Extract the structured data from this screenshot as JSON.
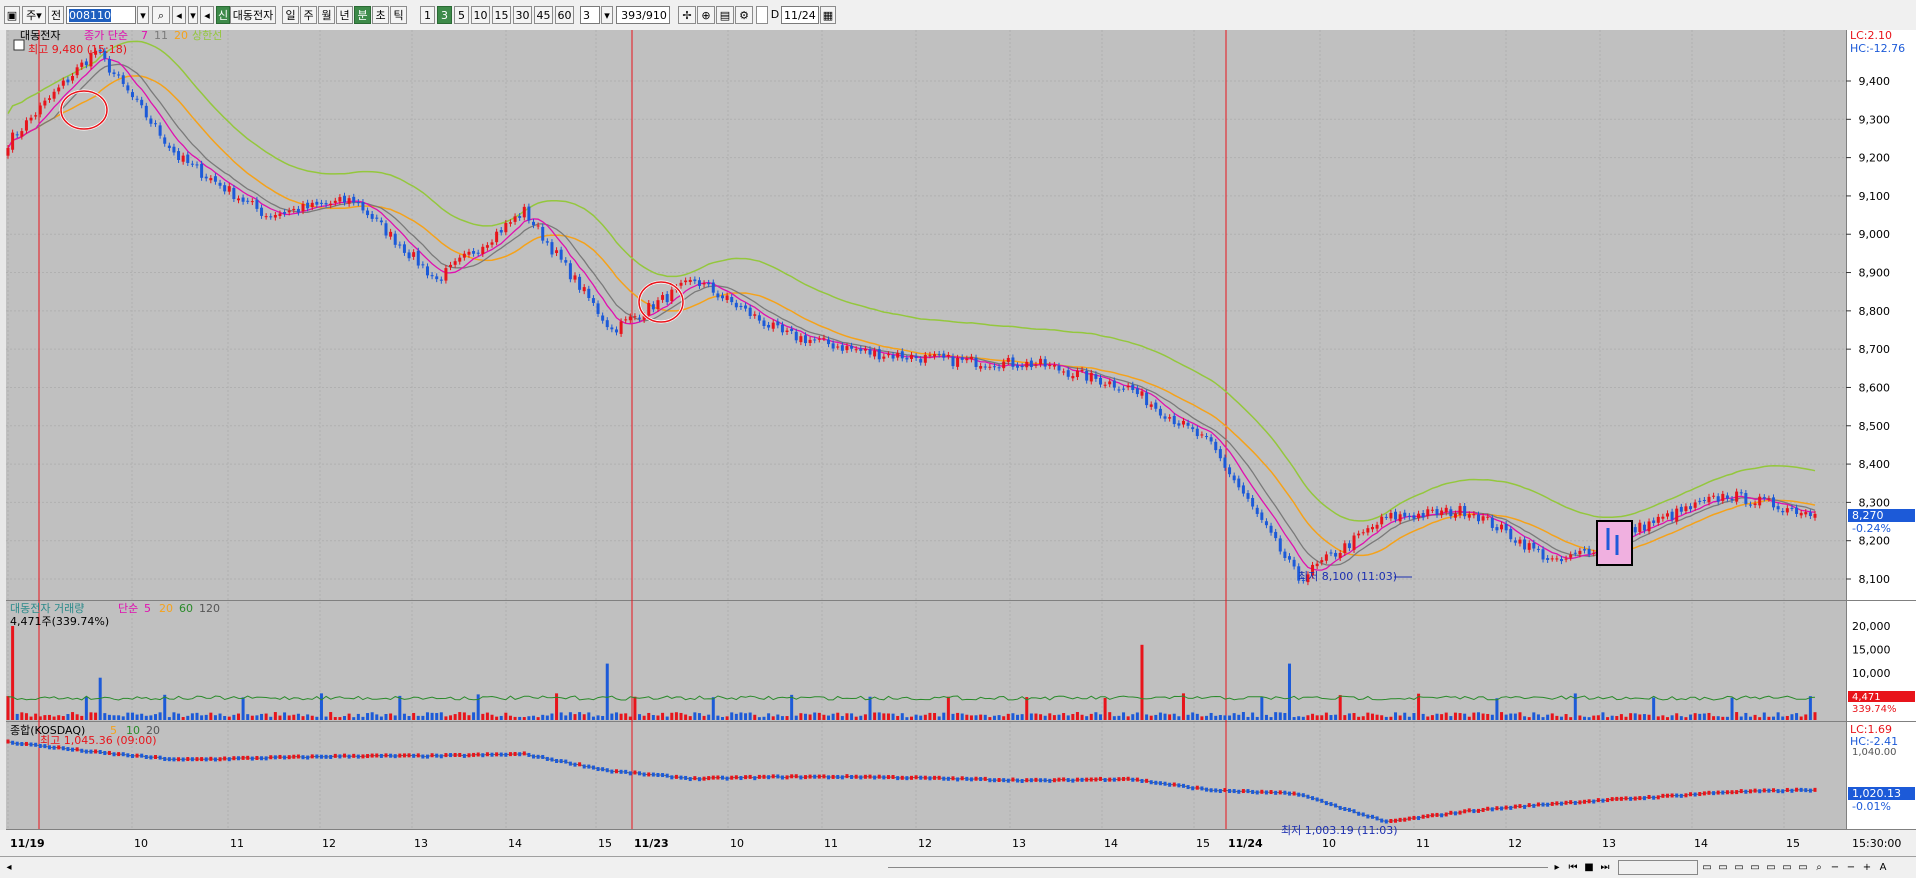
{
  "toolbar": {
    "item_type": "주",
    "market": "전",
    "code": "008110",
    "badge": "신",
    "stock_name": "대동전자",
    "period_buttons": [
      "일",
      "주",
      "월",
      "년",
      "분",
      "초",
      "틱"
    ],
    "active_period": "분",
    "interval_buttons": [
      "1",
      "3",
      "5",
      "10",
      "15",
      "30",
      "45",
      "60"
    ],
    "active_interval": "3",
    "custom_interval": "3",
    "count": "393/910",
    "d_label": "D",
    "date": "11/24"
  },
  "price_panel": {
    "legend": {
      "name": "대동전자",
      "ma_label": "종가 단순",
      "ma_periods": [
        "7",
        "11",
        "20"
      ],
      "band_label": "상한선"
    },
    "high_note": "최고 9,480 (15:18)",
    "low_note": "최저 8,100 (11:03)",
    "lc": "LC:2.10",
    "hc": "HC:-12.76",
    "current_price": "8,270",
    "current_change": "-0.24%",
    "y_labels": [
      "9,400",
      "9,300",
      "9,200",
      "9,100",
      "9,000",
      "8,900",
      "8,800",
      "8,700",
      "8,600",
      "8,500",
      "8,400",
      "8,300",
      "8,200",
      "8,100"
    ]
  },
  "volume_panel": {
    "legend": {
      "name": "대동전자 거래량",
      "ma_label": "단순",
      "ma_periods": [
        "5",
        "20",
        "60",
        "120"
      ]
    },
    "current_volume_note": "4,471주(339.74%)",
    "current_volume": "4,471",
    "current_pct": "339.74%",
    "y_labels": [
      "20,000",
      "15,000",
      "10,000",
      "5,000"
    ]
  },
  "index_panel": {
    "legend": {
      "name": "종합(KOSDAQ)",
      "ma_periods": [
        "5",
        "10",
        "20"
      ]
    },
    "high_note": "최고 1,045.36 (09:00)",
    "low_note": "최저 1,003.19 (11:03)",
    "lc": "LC:1.69",
    "hc": "HC:-2.41",
    "cut_label": "1,040.00",
    "current_value": "1,020.13",
    "current_change": "-0.01%"
  },
  "x_axis": {
    "labels": [
      "11/19",
      "10",
      "11",
      "12",
      "13",
      "14",
      "15",
      "11/23",
      "10",
      "11",
      "12",
      "13",
      "14",
      "15",
      "11/24",
      "10",
      "11",
      "12",
      "13",
      "14",
      "15"
    ],
    "time_label": "15:30:00"
  },
  "colors": {
    "up": "#e8141b",
    "down": "#1c5ad8",
    "ma7": "#e010b0",
    "ma11": "#7a7a7a",
    "ma20": "#f5a21a",
    "band": "#94c73d",
    "panel_bg": "#c0c0c0"
  },
  "chart_data": {
    "type": "candlestick",
    "unit": "3-minute bars",
    "days": [
      "11/19",
      "11/23",
      "11/24"
    ],
    "price_anchors": [
      {
        "label": "open 11/19",
        "value": 9240
      },
      {
        "label": "high 11/19 15:18",
        "value": 9480
      },
      {
        "label": "11/19 10",
        "value": 9200
      },
      {
        "label": "11/19 11",
        "value": 9050
      },
      {
        "label": "11/19 13",
        "value": 9090
      },
      {
        "label": "11/19 14",
        "value": 8880
      },
      {
        "label": "11/19 close",
        "value": 9060
      },
      {
        "label": "11/23 open",
        "value": 8750
      },
      {
        "label": "11/23 10",
        "value": 8880
      },
      {
        "label": "11/23 11",
        "value": 8740
      },
      {
        "label": "11/23 12",
        "value": 8690
      },
      {
        "label": "11/23 13",
        "value": 8670
      },
      {
        "label": "11/23 14",
        "value": 8660
      },
      {
        "label": "11/23 close",
        "value": 8600
      },
      {
        "label": "11/24 10",
        "value": 8450
      },
      {
        "label": "low 11/24 11:03",
        "value": 8100
      },
      {
        "label": "11/24 12",
        "value": 8260
      },
      {
        "label": "11/24 13",
        "value": 8280
      },
      {
        "label": "11/24 13:30",
        "value": 8140
      },
      {
        "label": "11/24 14",
        "value": 8240
      },
      {
        "label": "11/24 15",
        "value": 8320
      },
      {
        "label": "last",
        "value": 8270
      }
    ],
    "price_ylim": [
      8050,
      9500
    ],
    "volume_ylim": [
      0,
      22000
    ],
    "volume_peaks": [
      20000,
      16000,
      12000,
      9000
    ],
    "index_high": 1045.36,
    "index_low": 1003.19,
    "index_last": 1020.13
  }
}
